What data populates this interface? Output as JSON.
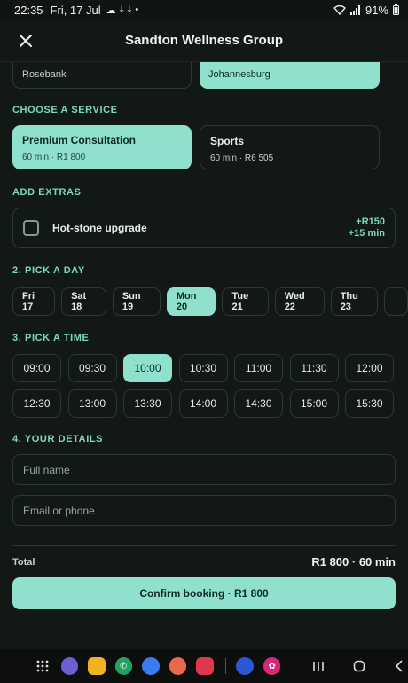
{
  "status_bar": {
    "time": "22:35",
    "date": "Fri, 17 Jul",
    "battery": "91%"
  },
  "header": {
    "title": "Sandton Wellness Group"
  },
  "locations": [
    {
      "label": "Rosebank",
      "selected": false
    },
    {
      "label": "Johannesburg",
      "selected": true
    }
  ],
  "service_section": {
    "label": "CHOOSE A SERVICE",
    "services": [
      {
        "name": "Premium Consultation",
        "meta": "60 min · R1 800",
        "selected": true
      },
      {
        "name": "Sports",
        "meta": "60 min · R6 505",
        "selected": false
      }
    ]
  },
  "extras_section": {
    "label": "ADD EXTRAS",
    "item": {
      "name": "Hot-stone upgrade",
      "price": "+R150",
      "duration": "+15 min",
      "checked": false
    }
  },
  "day_section": {
    "label": "2. PICK A DAY",
    "days": [
      "Fri 17",
      "Sat 18",
      "Sun 19",
      "Mon 20",
      "Tue 21",
      "Wed 22",
      "Thu 23"
    ],
    "selected": "Mon 20"
  },
  "time_section": {
    "label": "3. PICK A TIME",
    "times": [
      "09:00",
      "09:30",
      "10:00",
      "10:30",
      "11:00",
      "11:30",
      "12:00",
      "12:30",
      "13:00",
      "13:30",
      "14:00",
      "14:30",
      "15:00",
      "15:30"
    ],
    "selected": "10:00"
  },
  "details_section": {
    "label": "4. YOUR DETAILS",
    "name_placeholder": "Full name",
    "contact_placeholder": "Email or phone"
  },
  "summary": {
    "total_label": "Total",
    "total_value": "R1 800 · 60 min"
  },
  "confirm_button": "Confirm booking · R1 800",
  "colors": {
    "accent": "#8fe0cc",
    "background": "#121816",
    "section_label": "#7dd8c1"
  }
}
